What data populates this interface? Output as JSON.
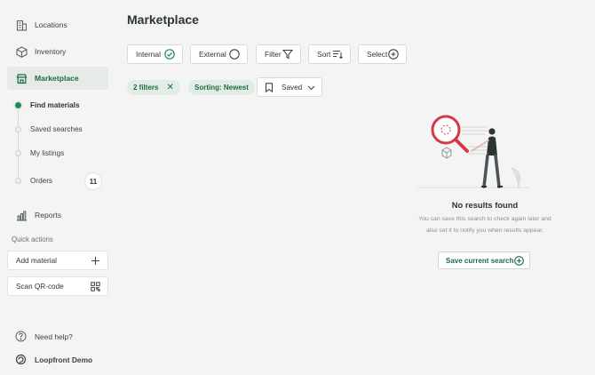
{
  "sidebar": {
    "items": [
      {
        "label": "Locations",
        "icon": "building-icon"
      },
      {
        "label": "Inventory",
        "icon": "cube-icon"
      },
      {
        "label": "Marketplace",
        "icon": "store-icon",
        "active": true
      }
    ],
    "sub_items": [
      {
        "label": "Find materials",
        "active": true
      },
      {
        "label": "Saved searches"
      },
      {
        "label": "My listings"
      },
      {
        "label": "Orders",
        "badge": "11"
      }
    ],
    "reports": {
      "label": "Reports",
      "icon": "bar-chart-icon"
    },
    "quick_actions_label": "Quick actions",
    "add_material": {
      "label": "Add material",
      "icon": "plus-icon"
    },
    "scan_qr": {
      "label": "Scan QR-code",
      "icon": "qr-code-icon"
    },
    "help": {
      "label": "Need help?",
      "icon": "question-circle-icon"
    },
    "account": {
      "label": "Loopfront Demo",
      "icon": "loopfront-logo-icon"
    }
  },
  "main": {
    "title": "Marketplace",
    "toolbar": {
      "internal": {
        "label": "Internal",
        "icon": "check-circle-icon",
        "checked": true
      },
      "external": {
        "label": "External",
        "icon": "empty-circle-icon",
        "checked": false
      },
      "filter": {
        "label": "Filter",
        "icon": "funnel-icon"
      },
      "sort": {
        "label": "Sort",
        "icon": "sort-lines-icon"
      },
      "select": {
        "label": "Select",
        "icon": "plus-circle-icon"
      }
    },
    "chips": {
      "filters": {
        "label": "2 filters",
        "icon": "close-icon"
      },
      "sorting": {
        "label": "Sorting: Newest"
      }
    },
    "saved": {
      "label": "Saved",
      "icon": "bookmark-icon"
    },
    "empty_state": {
      "title": "No results found",
      "line1": "You can save this search to check again later and",
      "line2": "also set it to notify you when results appear.",
      "save_button": "Save current search"
    }
  },
  "colors": {
    "accent": "#1e6b46",
    "accent_bright": "#1e8a55",
    "magnifier": "#d7364b",
    "background": "#f3f4f3"
  }
}
